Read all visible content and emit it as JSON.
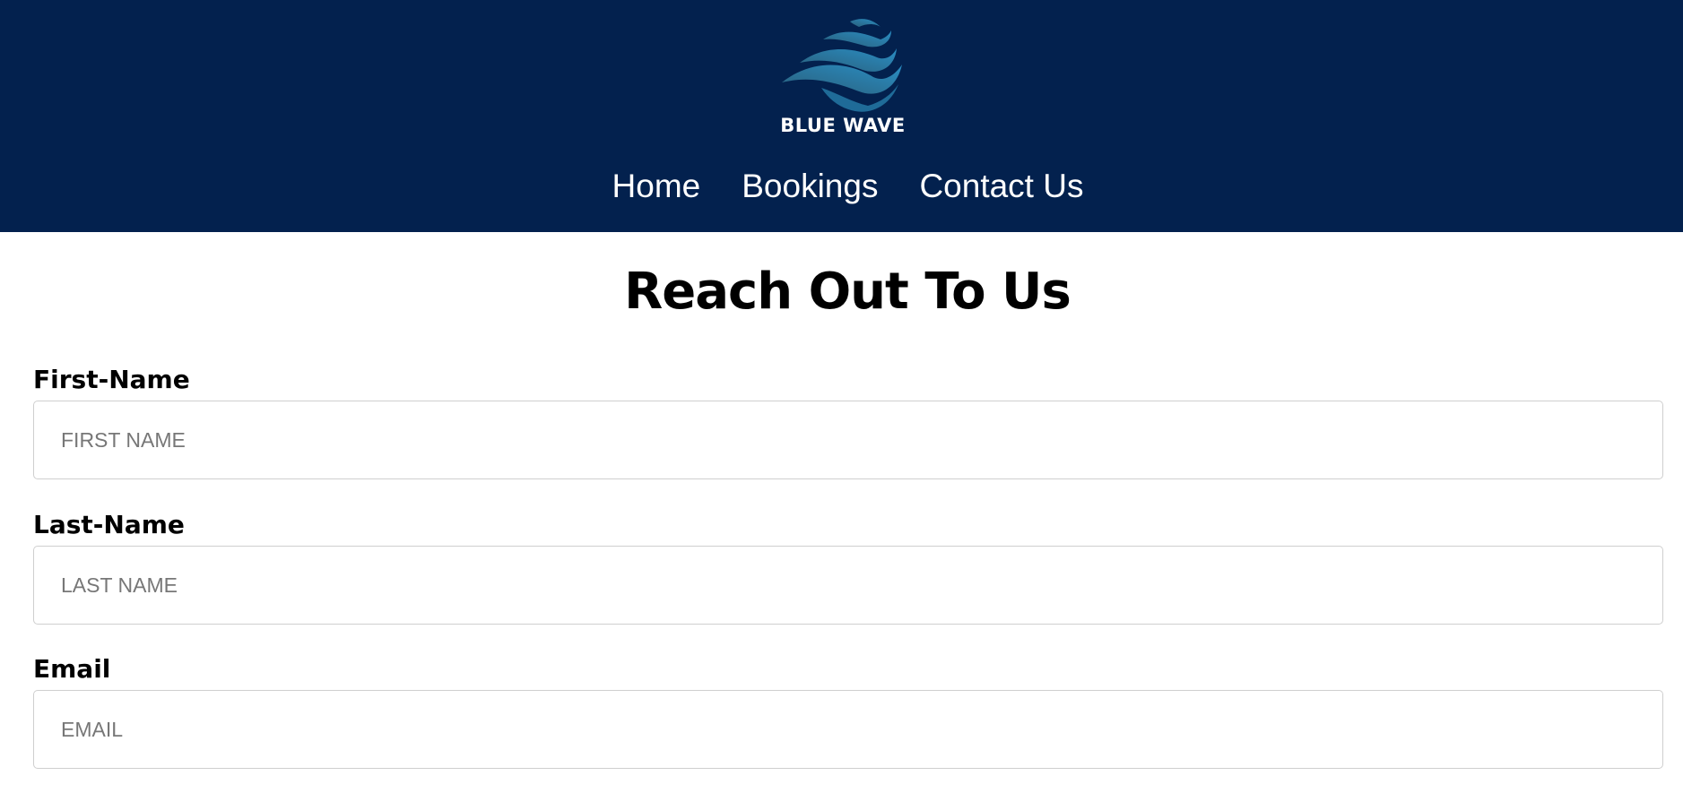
{
  "brand": {
    "name": "BLUE WAVE",
    "icon": "wave-logo-icon",
    "colors": {
      "header_bg": "#03214e",
      "wave_light": "#2a86b8",
      "wave_dark": "#1b5e86"
    }
  },
  "nav": {
    "items": [
      {
        "label": "Home"
      },
      {
        "label": "Bookings"
      },
      {
        "label": "Contact Us"
      }
    ]
  },
  "main": {
    "title": "Reach Out To Us",
    "form": {
      "first_name": {
        "label": "First-Name",
        "placeholder": "FIRST NAME",
        "value": ""
      },
      "last_name": {
        "label": "Last-Name",
        "placeholder": "LAST NAME",
        "value": ""
      },
      "email": {
        "label": "Email",
        "placeholder": "EMAIL",
        "value": ""
      }
    }
  }
}
